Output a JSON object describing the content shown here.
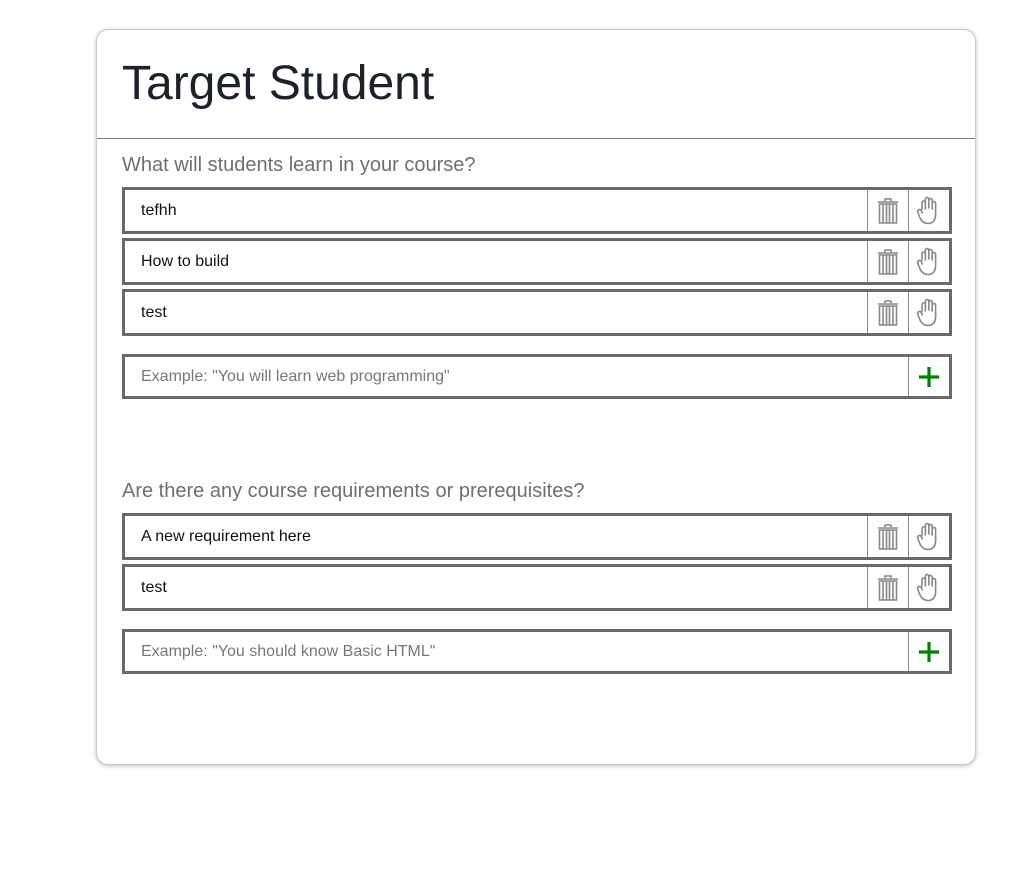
{
  "page": {
    "title": "Target Student"
  },
  "learn_section": {
    "label": "What will students learn in your course?",
    "items": [
      {
        "text": "tefhh"
      },
      {
        "text": "How to build"
      },
      {
        "text": "test"
      }
    ],
    "add_placeholder": "Example: \"You will learn web programming\""
  },
  "requirements_section": {
    "label": "Are there any course requirements or prerequisites?",
    "items": [
      {
        "text": "A new requirement here"
      },
      {
        "text": "test"
      }
    ],
    "add_placeholder": "Example: \"You should know Basic HTML\""
  },
  "icons": {
    "delete": "trash-icon",
    "drag": "hand-icon",
    "add": "plus-icon"
  },
  "colors": {
    "add_accent": "#008000",
    "border": "#6a6a6a",
    "label": "#6f6f6f"
  }
}
